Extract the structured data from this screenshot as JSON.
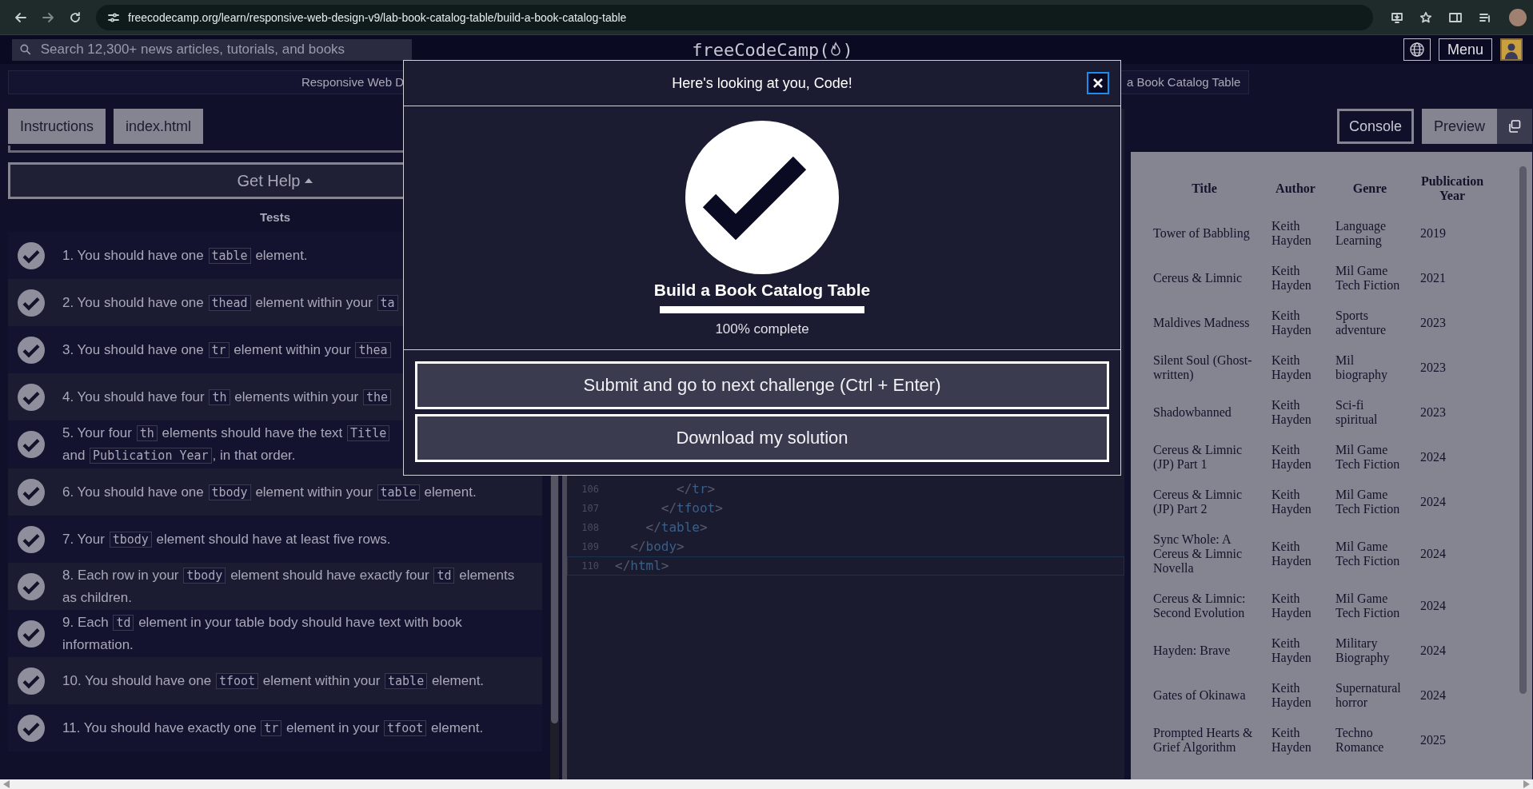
{
  "browser": {
    "url": "freecodecamp.org/learn/responsive-web-design-v9/lab-book-catalog-table/build-a-book-catalog-table"
  },
  "nav": {
    "search": {
      "placeholder": "Search 12,300+ news articles, tutorials, and books"
    },
    "logo": {
      "before": "freeCodeCamp(",
      "after": ")"
    },
    "menu_button": "Menu"
  },
  "breadcrumb": {
    "left": "Responsive Web D",
    "right": "a Book Catalog Table"
  },
  "left_tabs": [
    {
      "label": "Instructions"
    },
    {
      "label": "index.html"
    }
  ],
  "get_help": "Get Help",
  "tests_heading": "Tests",
  "tests": [
    {
      "passed": true,
      "parts": [
        {
          "kind": "text",
          "text": "1. You should have one "
        },
        {
          "kind": "code",
          "text": "table"
        },
        {
          "kind": "text",
          "text": " element."
        }
      ]
    },
    {
      "passed": true,
      "parts": [
        {
          "kind": "text",
          "text": "2. You should have one "
        },
        {
          "kind": "code",
          "text": "thead"
        },
        {
          "kind": "text",
          "text": " element within your "
        },
        {
          "kind": "code",
          "text": "ta"
        }
      ]
    },
    {
      "passed": true,
      "parts": [
        {
          "kind": "text",
          "text": "3. You should have one "
        },
        {
          "kind": "code",
          "text": "tr"
        },
        {
          "kind": "text",
          "text": " element within your "
        },
        {
          "kind": "code",
          "text": "thea"
        }
      ]
    },
    {
      "passed": true,
      "parts": [
        {
          "kind": "text",
          "text": "4. You should have four "
        },
        {
          "kind": "code",
          "text": "th"
        },
        {
          "kind": "text",
          "text": " elements within your "
        },
        {
          "kind": "code",
          "text": "the"
        }
      ]
    },
    {
      "passed": true,
      "parts": [
        {
          "kind": "text",
          "text": "5. Your four "
        },
        {
          "kind": "code",
          "text": "th"
        },
        {
          "kind": "text",
          "text": " elements should have the text "
        },
        {
          "kind": "code",
          "text": "Title"
        },
        {
          "kind": "break"
        },
        {
          "kind": "text",
          "text": "and "
        },
        {
          "kind": "code",
          "text": "Publication Year"
        },
        {
          "kind": "text",
          "text": ", in that order."
        }
      ]
    },
    {
      "passed": true,
      "parts": [
        {
          "kind": "text",
          "text": "6. You should have one "
        },
        {
          "kind": "code",
          "text": "tbody"
        },
        {
          "kind": "text",
          "text": " element within your "
        },
        {
          "kind": "code",
          "text": "table"
        },
        {
          "kind": "text",
          "text": " element."
        }
      ]
    },
    {
      "passed": true,
      "parts": [
        {
          "kind": "text",
          "text": "7. Your "
        },
        {
          "kind": "code",
          "text": "tbody"
        },
        {
          "kind": "text",
          "text": " element should have at least five rows."
        }
      ]
    },
    {
      "passed": true,
      "parts": [
        {
          "kind": "text",
          "text": "8. Each row in your "
        },
        {
          "kind": "code",
          "text": "tbody"
        },
        {
          "kind": "text",
          "text": " element should have exactly four "
        },
        {
          "kind": "code",
          "text": "td"
        },
        {
          "kind": "text",
          "text": " elements as children."
        }
      ]
    },
    {
      "passed": true,
      "parts": [
        {
          "kind": "text",
          "text": "9. Each "
        },
        {
          "kind": "code",
          "text": "td"
        },
        {
          "kind": "text",
          "text": " element in your table body should have text with book information."
        }
      ]
    },
    {
      "passed": true,
      "parts": [
        {
          "kind": "text",
          "text": "10. You should have one "
        },
        {
          "kind": "code",
          "text": "tfoot"
        },
        {
          "kind": "text",
          "text": " element within your "
        },
        {
          "kind": "code",
          "text": "table"
        },
        {
          "kind": "text",
          "text": " element."
        }
      ]
    },
    {
      "passed": true,
      "parts": [
        {
          "kind": "text",
          "text": "11. You should have exactly one "
        },
        {
          "kind": "code",
          "text": "tr"
        },
        {
          "kind": "text",
          "text": " element in your "
        },
        {
          "kind": "code",
          "text": "tfoot"
        },
        {
          "kind": "text",
          "text": " element."
        }
      ]
    }
  ],
  "editor": {
    "lines": [
      {
        "number": "106",
        "code": "        </tr>",
        "current": false
      },
      {
        "number": "107",
        "code": "      </tfoot>",
        "current": false
      },
      {
        "number": "108",
        "code": "    </table>",
        "current": false
      },
      {
        "number": "109",
        "code": "  </body>",
        "current": false
      },
      {
        "number": "110",
        "code": "</html>",
        "current": true
      }
    ]
  },
  "right_tabs": [
    {
      "label": "Console",
      "selected": false
    },
    {
      "label": "Preview",
      "selected": true
    }
  ],
  "preview_table": {
    "columns": [
      "Title",
      "Author",
      "Genre",
      "Publication Year"
    ],
    "rows": [
      [
        "Tower of Babbling",
        "Keith Hayden",
        "Language Learning",
        "2019"
      ],
      [
        "Cereus & Limnic",
        "Keith Hayden",
        "Mil Game Tech Fiction",
        "2021"
      ],
      [
        "Maldives Madness",
        "Keith Hayden",
        "Sports adventure",
        "2023"
      ],
      [
        "Silent Soul (Ghost-written)",
        "Keith Hayden",
        "Mil biography",
        "2023"
      ],
      [
        "Shadowbanned",
        "Keith Hayden",
        "Sci-fi spiritual",
        "2023"
      ],
      [
        "Cereus & Limnic (JP) Part 1",
        "Keith Hayden",
        "Mil Game Tech Fiction",
        "2024"
      ],
      [
        "Cereus & Limnic (JP) Part 2",
        "Keith Hayden",
        "Mil Game Tech Fiction",
        "2024"
      ],
      [
        "Sync Whole: A Cereus & Limnic Novella",
        "Keith Hayden",
        "Mil Game Tech Fiction",
        "2024"
      ],
      [
        "Cereus & Limnic: Second Evolution",
        "Keith Hayden",
        "Mil Game Tech Fiction",
        "2024"
      ],
      [
        "Hayden: Brave",
        "Keith Hayden",
        "Military Biography",
        "2024"
      ],
      [
        "Gates of Okinawa",
        "Keith Hayden",
        "Supernatural horror",
        "2024"
      ],
      [
        "Prompted Hearts & Grief Algorithm",
        "Keith Hayden",
        "Techno Romance",
        "2025"
      ]
    ]
  },
  "modal": {
    "title": "Here's looking at you, Code!",
    "challenge": "Build a Book Catalog Table",
    "progress": {
      "level": 1,
      "reading": "100% complete"
    },
    "buttons": [
      "Submit and go to next challenge (Ctrl + Enter)",
      "Download my solution"
    ]
  }
}
